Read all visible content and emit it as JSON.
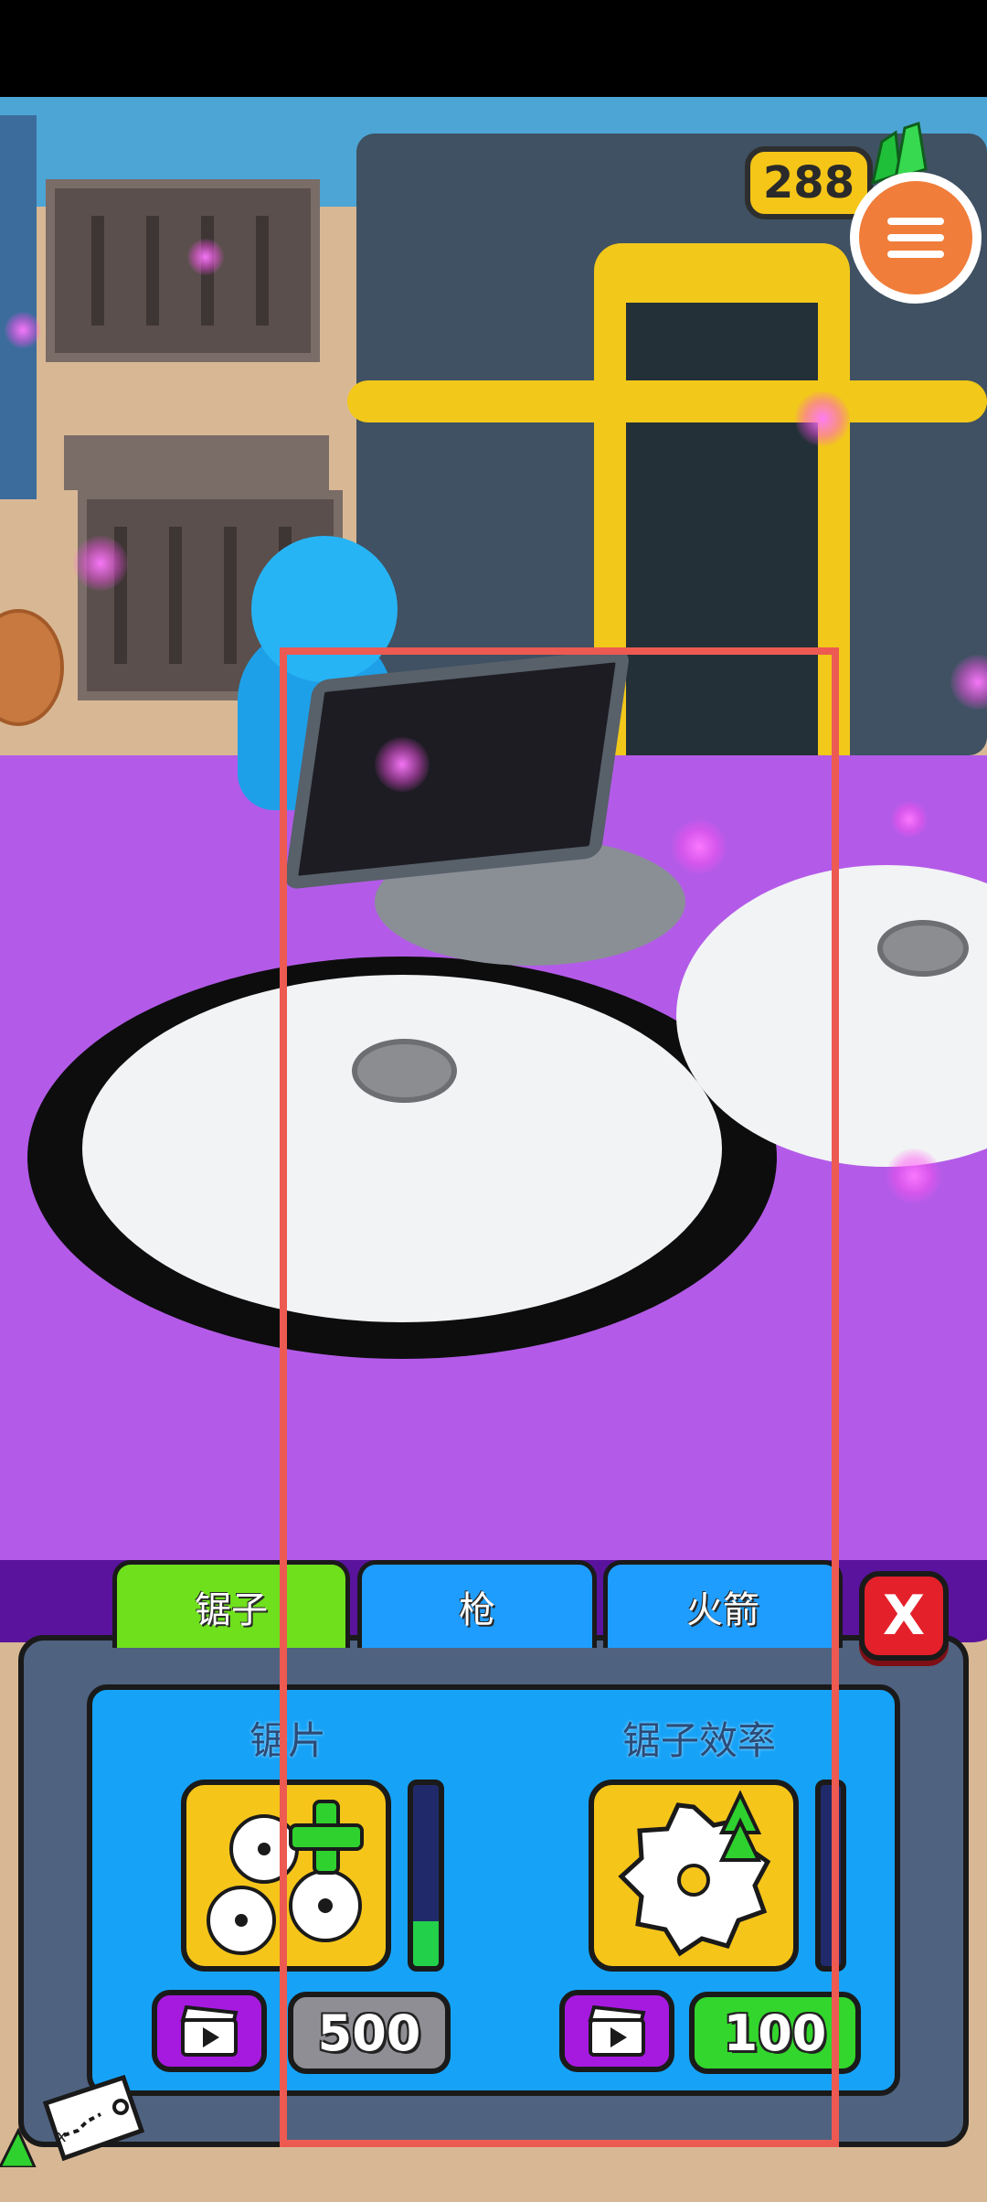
{
  "hud": {
    "currency_value": "288",
    "gem_icon": "green-gem-icon",
    "menu_icon": "hamburger-icon"
  },
  "tabs": [
    {
      "label": "锯子",
      "active": true,
      "color": "#6fe01c"
    },
    {
      "label": "枪",
      "active": false,
      "color": "#1f9dff"
    },
    {
      "label": "火箭",
      "active": false,
      "color": "#1f9dff"
    }
  ],
  "close_label": "X",
  "upgrades": {
    "blades": {
      "title": "锯片",
      "icon": "gears-plus-icon",
      "progress": 0.25,
      "price": "500",
      "ad_icon": "video-clapper-icon"
    },
    "efficiency": {
      "title": "锯子效率",
      "icon": "saw-blade-up-icon",
      "progress": 0,
      "price": "100",
      "ad_icon": "video-clapper-icon"
    }
  },
  "map_icon": "treasure-map-icon",
  "chest_icon": "treasure-chest-icon",
  "colors": {
    "accent_orange": "#f07d3a",
    "panel": "#4f6280",
    "panel_inner": "#16a3f7",
    "highlight_box": "#ec5a52",
    "mat_purple": "#b35be8"
  }
}
